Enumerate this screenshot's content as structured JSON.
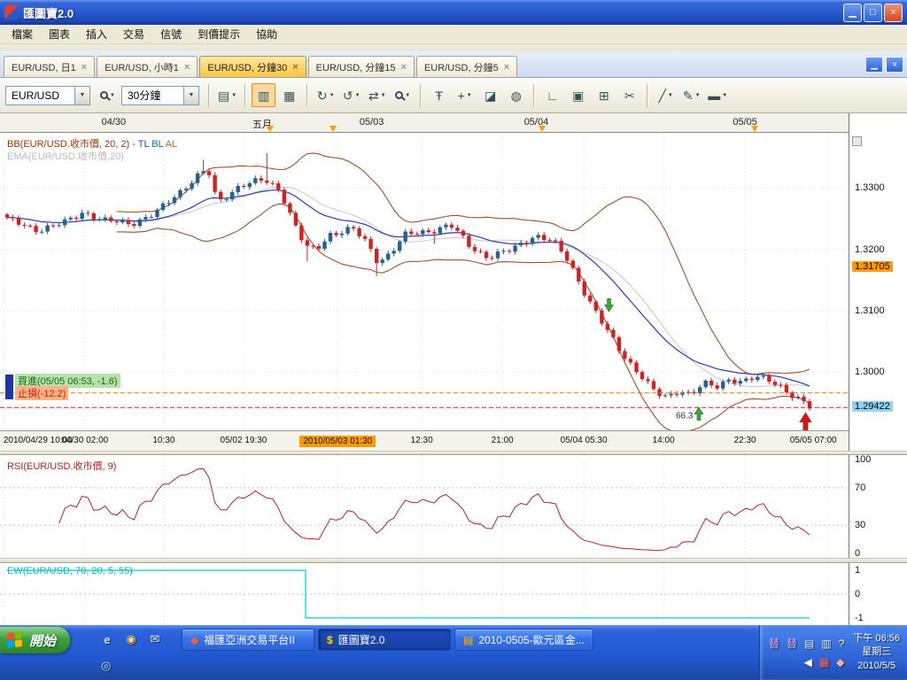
{
  "window": {
    "title": "匯圖寶2.0"
  },
  "icons": {
    "minimize": "▁",
    "maximize": "□",
    "close": "×",
    "dropdown": "▼",
    "tab_close": "×"
  },
  "menu": {
    "items": [
      "檔案",
      "圖表",
      "插入",
      "交易",
      "信號",
      "到價提示",
      "協助"
    ]
  },
  "tabs": {
    "items": [
      {
        "label": "EUR/USD, 日1",
        "active": false
      },
      {
        "label": "EUR/USD, 小時1",
        "active": false
      },
      {
        "label": "EUR/USD, 分鐘30",
        "active": true
      },
      {
        "label": "EUR/USD, 分鐘15",
        "active": false
      },
      {
        "label": "EUR/USD, 分鐘5",
        "active": false
      }
    ]
  },
  "toolbar": {
    "controls": [
      {
        "type": "combo",
        "name": "symbol-select",
        "value": "EUR/USD",
        "width": 96
      },
      {
        "type": "button",
        "name": "indicator-search-button",
        "icon": "magnifier",
        "dropdown": true
      },
      {
        "type": "combo",
        "name": "period-select",
        "value": "30分鐘",
        "width": 88
      },
      {
        "type": "sep"
      },
      {
        "type": "button",
        "name": "new-chart-button",
        "glyph": "▤",
        "dropdown": true
      },
      {
        "type": "sep"
      },
      {
        "type": "button",
        "name": "candlestick-view-button",
        "glyph": "▥",
        "active": true
      },
      {
        "type": "button",
        "name": "data-table-button",
        "glyph": "▦"
      },
      {
        "type": "sep"
      },
      {
        "type": "button",
        "name": "script-run-button",
        "glyph": "↻",
        "dropdown": true
      },
      {
        "type": "button",
        "name": "signal-scan-button",
        "glyph": "↺",
        "dropdown": true
      },
      {
        "type": "button",
        "name": "strategy-test-button",
        "glyph": "⇄",
        "dropdown": true
      },
      {
        "type": "button",
        "name": "zoom-button",
        "icon": "magnifier",
        "dropdown": true
      },
      {
        "type": "sep"
      },
      {
        "type": "button",
        "name": "interval-marker-button",
        "glyph": "Ŧ"
      },
      {
        "type": "button",
        "name": "crosshair-button",
        "glyph": "+",
        "dropdown": true
      },
      {
        "type": "button",
        "name": "eraser-button",
        "glyph": "◪"
      },
      {
        "type": "button",
        "name": "world-button",
        "glyph": "◍"
      },
      {
        "type": "sep"
      },
      {
        "type": "button",
        "name": "ruler-button",
        "glyph": "∟"
      },
      {
        "type": "button",
        "name": "snapshot-button",
        "glyph": "▣"
      },
      {
        "type": "button",
        "name": "export-image-button",
        "glyph": "⊞"
      },
      {
        "type": "button",
        "name": "scissors-button",
        "glyph": "✂"
      },
      {
        "type": "sep"
      },
      {
        "type": "button",
        "name": "trendline-button",
        "glyph": "╱",
        "dropdown": true
      },
      {
        "type": "button",
        "name": "pencil-button",
        "glyph": "✎",
        "dropdown": true
      },
      {
        "type": "button",
        "name": "highlighter-button",
        "glyph": "▬",
        "dropdown": true
      }
    ]
  },
  "chart_data": {
    "type": "candlestick",
    "symbol": "EUR/USD",
    "period": "30分鐘",
    "legends": {
      "bb": [
        {
          "text": "BB(EUR/USD.收市價, 20, 2) - ",
          "color": "#993300"
        },
        {
          "text": "TL ",
          "color": "#2244cc"
        },
        {
          "text": "BL ",
          "color": "#0077aa"
        },
        {
          "text": "AL",
          "color": "#cc6600"
        }
      ],
      "ema": {
        "text": "EMA(EUR/USD.收市價,20)",
        "color": "#b8b8b8"
      },
      "rsi": {
        "text": "RSI(EUR/USD.收市價, 9)",
        "color": "#b22222"
      },
      "ew": {
        "text": "EW(EUR/USD, 70, 20, 5, 55)",
        "color": "#00b8c8"
      }
    },
    "trade": {
      "buy_text": "買進(05/05 06:53, -1.6)",
      "stop_text": "止損(-12.2)",
      "buy_bg": "#b7e3a8",
      "buy_color": "#19651a",
      "stop_bg": "#ffb286",
      "stop_color": "#c22000",
      "bar_color": "#20379c"
    },
    "date_axis": {
      "labels": [
        {
          "text": "04/30",
          "frac": 0.134
        },
        {
          "text": "五月",
          "frac": 0.309
        },
        {
          "text": "05/03",
          "frac": 0.438
        },
        {
          "text": "05/04",
          "frac": 0.632
        },
        {
          "text": "05/05",
          "frac": 0.878
        }
      ],
      "triangles": [
        0.318,
        0.392,
        0.639,
        0.889
      ]
    },
    "x_axis": {
      "labels": [
        "2010/04/29 10:00",
        "04/30 02:00",
        "10:30",
        "05/02 19:30",
        "2010/05/03 01:30",
        "12:30",
        "21:00",
        "05/04 05:30",
        "14:00",
        "22:30",
        "05/05 07:00"
      ],
      "fracs": [
        0.004,
        0.1,
        0.193,
        0.287,
        0.398,
        0.497,
        0.592,
        0.688,
        0.782,
        0.878,
        0.975
      ],
      "highlight_index": 4,
      "highlight_bg": "#ff9a00"
    },
    "price_axis": {
      "min": 1.2905,
      "max": 1.339,
      "ticks": [
        {
          "label": "1.3300",
          "value": 1.33
        },
        {
          "label": "1.3200",
          "value": 1.32
        },
        {
          "label": "1.3100",
          "value": 1.31
        },
        {
          "label": "1.3000",
          "value": 1.3
        }
      ],
      "chips": [
        {
          "text": "1.31705",
          "price": 1.31705,
          "bg": "#ff9a00"
        },
        {
          "text": "1.29422",
          "price": 1.29422,
          "bg": "#8fd4f0"
        }
      ]
    },
    "candles": {
      "count": 140,
      "width": 4.4,
      "up_color": "#27618e",
      "down_color": "#cc2424",
      "close_anchors": [
        [
          0.0,
          1.3248
        ],
        [
          0.04,
          1.3232
        ],
        [
          0.07,
          1.3242
        ],
        [
          0.095,
          1.3262
        ],
        [
          0.12,
          1.3246
        ],
        [
          0.155,
          1.3243
        ],
        [
          0.185,
          1.3258
        ],
        [
          0.21,
          1.3288
        ],
        [
          0.235,
          1.3318
        ],
        [
          0.25,
          1.333
        ],
        [
          0.262,
          1.3275
        ],
        [
          0.29,
          1.3305
        ],
        [
          0.32,
          1.3312
        ],
        [
          0.34,
          1.3298
        ],
        [
          0.358,
          1.3242
        ],
        [
          0.372,
          1.3203
        ],
        [
          0.385,
          1.3198
        ],
        [
          0.402,
          1.3225
        ],
        [
          0.43,
          1.3234
        ],
        [
          0.448,
          1.321
        ],
        [
          0.462,
          1.318
        ],
        [
          0.478,
          1.3195
        ],
        [
          0.495,
          1.3222
        ],
        [
          0.525,
          1.323
        ],
        [
          0.552,
          1.324
        ],
        [
          0.578,
          1.3203
        ],
        [
          0.6,
          1.3188
        ],
        [
          0.628,
          1.3198
        ],
        [
          0.658,
          1.3224
        ],
        [
          0.68,
          1.3213
        ],
        [
          0.7,
          1.318
        ],
        [
          0.72,
          1.313
        ],
        [
          0.742,
          1.3078
        ],
        [
          0.765,
          1.3032
        ],
        [
          0.788,
          1.2998
        ],
        [
          0.808,
          1.2965
        ],
        [
          0.822,
          1.2958
        ],
        [
          0.838,
          1.2972
        ],
        [
          0.852,
          1.2964
        ],
        [
          0.868,
          1.298
        ],
        [
          0.884,
          1.2975
        ],
        [
          0.9,
          1.299
        ],
        [
          0.916,
          1.2984
        ],
        [
          0.932,
          1.299
        ],
        [
          0.948,
          1.2988
        ],
        [
          0.962,
          1.298
        ],
        [
          0.978,
          1.2962
        ],
        [
          1.0,
          1.2942
        ]
      ],
      "spikes": [
        {
          "frac": 0.247,
          "dir": "up",
          "len": 0.0016
        },
        {
          "frac": 0.322,
          "dir": "up",
          "len": 0.0042
        },
        {
          "frac": 0.375,
          "dir": "down",
          "len": 0.0022
        },
        {
          "frac": 0.462,
          "dir": "down",
          "len": 0.0018
        },
        {
          "frac": 0.53,
          "dir": "down",
          "len": 0.0012
        }
      ]
    },
    "indicators": {
      "bollinger": {
        "period": 20,
        "dev": 2,
        "band_color": "#a0522d",
        "mid_color": "#c8c8c8"
      },
      "ema": {
        "period": 20,
        "color": "#2a3db8"
      }
    },
    "dashed_lines": [
      {
        "price": 1.2966,
        "color": "#e07818"
      },
      {
        "price": 1.29422,
        "color": "#d02020"
      }
    ],
    "markers": [
      {
        "name": "sell-signal-arrow-icon",
        "frac": 0.75,
        "price": 1.3098,
        "dir": "down",
        "color": "#33aa33",
        "big": false
      },
      {
        "name": "buy-signal-arrow-icon",
        "frac": 0.862,
        "price": 1.2943,
        "dir": "up",
        "color": "#33aa33",
        "big": false,
        "label": "66.3"
      },
      {
        "name": "alert-arrow-icon",
        "frac": 0.995,
        "price": 1.2934,
        "dir": "up",
        "color": "#dd1111",
        "big": true
      }
    ],
    "rsi": {
      "period": 9,
      "color": "#b22222",
      "range": [
        -5,
        105
      ],
      "dotted": [
        70,
        30
      ],
      "ticks": [
        {
          "label": "100",
          "value": 100
        },
        {
          "label": "70",
          "value": 70
        },
        {
          "label": "30",
          "value": 30
        },
        {
          "label": "0",
          "value": 0
        }
      ]
    },
    "ew": {
      "color": "#00cfd6",
      "range": [
        -1.3,
        1.3
      ],
      "path": [
        [
          0,
          1
        ],
        [
          0.372,
          1
        ],
        [
          0.372,
          -1
        ],
        [
          1,
          -1
        ]
      ],
      "ticks": [
        {
          "label": "1",
          "value": 1
        },
        {
          "label": "0",
          "value": 0
        },
        {
          "label": "-1",
          "value": -1
        }
      ]
    }
  },
  "taskbar": {
    "start_label": "開始",
    "flag_colors": [
      "#f25022",
      "#7fba00",
      "#00a4ef",
      "#ffb900"
    ],
    "quick_launch": [
      {
        "name": "ie-icon",
        "glyph": "e",
        "color": "#cfe4ff"
      },
      {
        "name": "media-player-icon",
        "glyph": "◉",
        "color": "#ffd37a"
      },
      {
        "name": "mail-icon",
        "glyph": "✉",
        "color": "#eef2ff"
      }
    ],
    "row2_icon": {
      "name": "messenger-icon",
      "glyph": "◎",
      "color": "#bfe0ff"
    },
    "tasks": [
      {
        "label": "福匯亞洲交易平台II",
        "icon": "◆",
        "icon_color": "#ff5a3c",
        "active": false
      },
      {
        "label": "匯圖寶2.0",
        "icon": "$",
        "icon_color": "#ffd400",
        "active": true
      },
      {
        "label": "2010-0505-歐元區金...",
        "icon": "▤",
        "icon_color": "#ffb400",
        "active": false
      }
    ],
    "tray_row1": [
      {
        "glyph": "替",
        "color": "#d9b3ff"
      },
      {
        "glyph": "替",
        "color": "#d9b3ff"
      },
      {
        "glyph": "▤",
        "color": "#e6ecff"
      },
      {
        "glyph": "▥",
        "color": "#e6ecff"
      },
      {
        "glyph": "?",
        "color": "#ffffff"
      }
    ],
    "tray_row2": [
      {
        "glyph": "◀",
        "color": "#ffffff"
      },
      {
        "glyph": "▦",
        "color": "#ff6a5a"
      },
      {
        "glyph": "◆",
        "color": "#ffb0a0"
      }
    ],
    "clock": [
      "下午 06:56",
      "星期三",
      "2010/5/5"
    ]
  }
}
